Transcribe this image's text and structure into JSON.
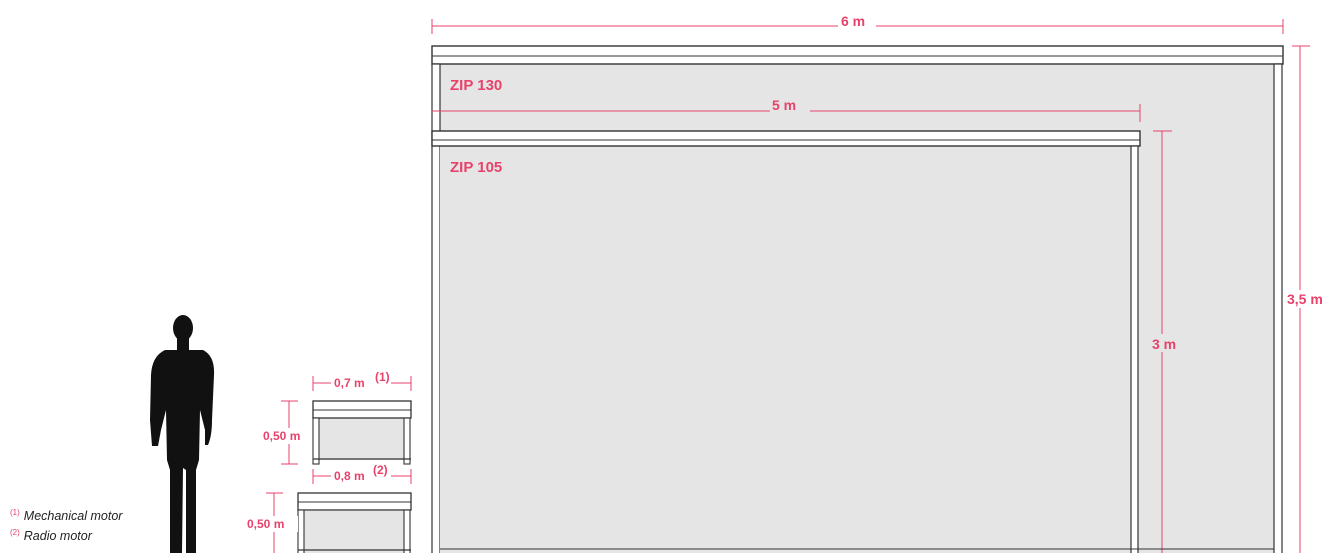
{
  "colors": {
    "accent": "#e8426b",
    "panel": "#e4e5e4",
    "frame": "#333333"
  },
  "large": {
    "name": "ZIP 130",
    "width": "6 m",
    "height": "3,5 m"
  },
  "medium": {
    "name": "ZIP 105",
    "width": "5 m",
    "height": "3 m"
  },
  "small_top": {
    "width": "0,7 m",
    "width_note": "(1)",
    "height": "0,50 m"
  },
  "small_bottom": {
    "width": "0,8 m",
    "width_note": "(2)",
    "height": "0,50 m"
  },
  "legend": [
    {
      "mark": "(1)",
      "text": "Mechanical motor"
    },
    {
      "mark": "(2)",
      "text": "Radio motor"
    }
  ],
  "icons": {
    "person": "person-silhouette-icon"
  }
}
